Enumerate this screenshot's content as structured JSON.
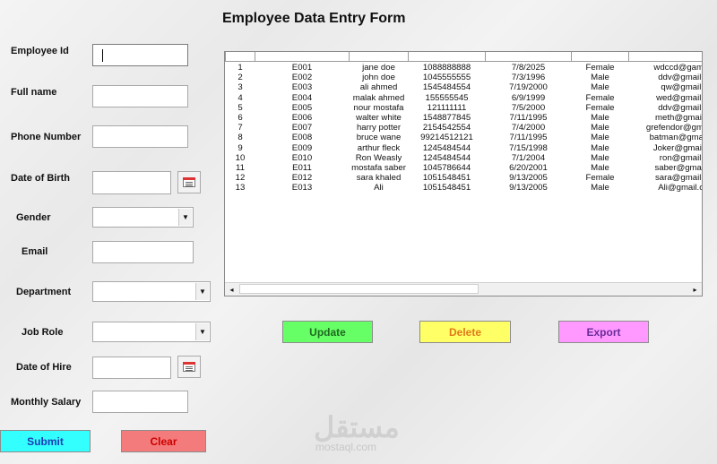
{
  "form": {
    "title": "Employee Data Entry Form",
    "labels": {
      "employee_id": "Employee Id",
      "full_name": "Full name",
      "phone": "Phone Number",
      "dob": "Date of Birth",
      "gender": "Gender",
      "email": "Email",
      "department": "Department",
      "job_role": "Job Role",
      "date_of_hire": "Date of Hire",
      "monthly_salary": "Monthly Salary"
    },
    "values": {
      "employee_id": "",
      "full_name": "",
      "phone": "",
      "dob": "",
      "gender": "",
      "email": "",
      "department": "",
      "job_role": "",
      "date_of_hire": "",
      "monthly_salary": ""
    },
    "icons": {
      "calendar": "calendar-icon",
      "dropdown": "chevron-down-icon"
    }
  },
  "buttons": {
    "submit": "Submit",
    "clear": "Clear",
    "update": "Update",
    "delete": "Delete",
    "export": "Export"
  },
  "colors": {
    "submit": "#33ffff",
    "clear": "#f47b7b",
    "update": "#66ff66",
    "delete": "#ffff66",
    "export": "#ff99ff",
    "delete_text": "#e07a1a",
    "clear_text": "#cc0000",
    "export_text": "#6a2c9a"
  },
  "table": {
    "rows": [
      [
        "1",
        "E001",
        "jane doe",
        "1088888888",
        "7/8/2025",
        "Female",
        "wdccd@gam"
      ],
      [
        "2",
        "E002",
        "john doe",
        "1045555555",
        "7/3/1996",
        "Male",
        "ddv@gmail."
      ],
      [
        "3",
        "E003",
        "ali ahmed",
        "1545484554",
        "7/19/2000",
        "Male",
        "qw@gmail."
      ],
      [
        "4",
        "E004",
        "malak ahmed",
        "155555545",
        "6/9/1999",
        "Female",
        "wed@gmail."
      ],
      [
        "5",
        "E005",
        "nour mostafa",
        "121111111",
        "7/5/2000",
        "Female",
        "ddv@gmail."
      ],
      [
        "6",
        "E006",
        "walter white",
        "1548877845",
        "7/11/1995",
        "Male",
        "meth@gmail"
      ],
      [
        "7",
        "E007",
        "harry potter",
        "2154542554",
        "7/4/2000",
        "Male",
        "grefendor@gm"
      ],
      [
        "8",
        "E008",
        "bruce wane",
        "99214512121",
        "7/11/1995",
        "Male",
        "batman@gma"
      ],
      [
        "9",
        "E009",
        "arthur fleck",
        "1245484544",
        "7/15/1998",
        "Male",
        "Joker@gmail"
      ],
      [
        "10",
        "E010",
        "Ron Weasly",
        "1245484544",
        "7/1/2004",
        "Male",
        "ron@gmail."
      ],
      [
        "11",
        "E011",
        "mostafa saber",
        "1045786644",
        "6/20/2001",
        "Male",
        "saber@gmai"
      ],
      [
        "12",
        "E012",
        "sara khaled",
        "1051548451",
        "9/13/2005",
        "Female",
        "sara@gmail."
      ],
      [
        "13",
        "E013",
        "Ali",
        "1051548451",
        "9/13/2005",
        "Male",
        "Ali@gmail.c"
      ]
    ],
    "scroll": {
      "left_arrow": "◂",
      "right_arrow": "▸"
    }
  },
  "watermark": {
    "arabic": "مستقل",
    "latin": "mostaql.com"
  }
}
